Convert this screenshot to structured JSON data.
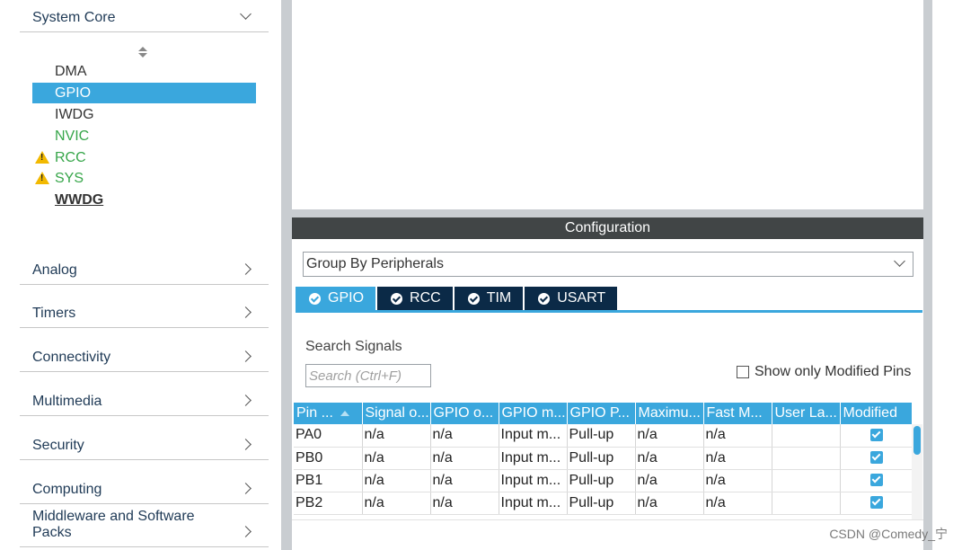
{
  "sidebar": {
    "categories": [
      {
        "label": "System Core",
        "expanded": true
      },
      {
        "label": "Analog"
      },
      {
        "label": "Timers"
      },
      {
        "label": "Connectivity"
      },
      {
        "label": "Multimedia"
      },
      {
        "label": "Security"
      },
      {
        "label": "Computing"
      },
      {
        "label": "Middleware and Software Packs"
      }
    ],
    "system_core_items": [
      {
        "label": "DMA",
        "state": "normal"
      },
      {
        "label": "GPIO",
        "state": "selected"
      },
      {
        "label": "IWDG",
        "state": "normal"
      },
      {
        "label": "NVIC",
        "state": "configured"
      },
      {
        "label": "RCC",
        "state": "warning"
      },
      {
        "label": "SYS",
        "state": "warning"
      },
      {
        "label": "WWDG",
        "state": "bold"
      }
    ],
    "warning_icon_glyph": "!"
  },
  "config": {
    "header": "Configuration",
    "group_select": "Group By Peripherals",
    "tabs": [
      "GPIO",
      "RCC",
      "TIM",
      "USART"
    ],
    "active_tab": "GPIO",
    "search_label": "Search Signals",
    "search_placeholder": "Search (Ctrl+F)",
    "modified_only_label": "Show only Modified Pins",
    "table": {
      "columns": [
        "Pin ...",
        "Signal o...",
        "GPIO o...",
        "GPIO m...",
        "GPIO P...",
        "Maximu...",
        "Fast M...",
        "User La...",
        "Modified"
      ],
      "rows": [
        [
          "PA0",
          "n/a",
          "n/a",
          "Input m...",
          "Pull-up",
          "n/a",
          "n/a",
          "",
          true
        ],
        [
          "PB0",
          "n/a",
          "n/a",
          "Input m...",
          "Pull-up",
          "n/a",
          "n/a",
          "",
          true
        ],
        [
          "PB1",
          "n/a",
          "n/a",
          "Input m...",
          "Pull-up",
          "n/a",
          "n/a",
          "",
          true
        ],
        [
          "PB2",
          "n/a",
          "n/a",
          "Input m...",
          "Pull-up",
          "n/a",
          "n/a",
          "",
          true
        ]
      ]
    }
  },
  "watermark": "CSDN @Comedy_宁",
  "colors": {
    "accent": "#3aa7dd",
    "tab_dark": "#0b2a47",
    "header_dark": "#414546",
    "configured_green": "#37a64a",
    "warning": "#f2b900"
  }
}
